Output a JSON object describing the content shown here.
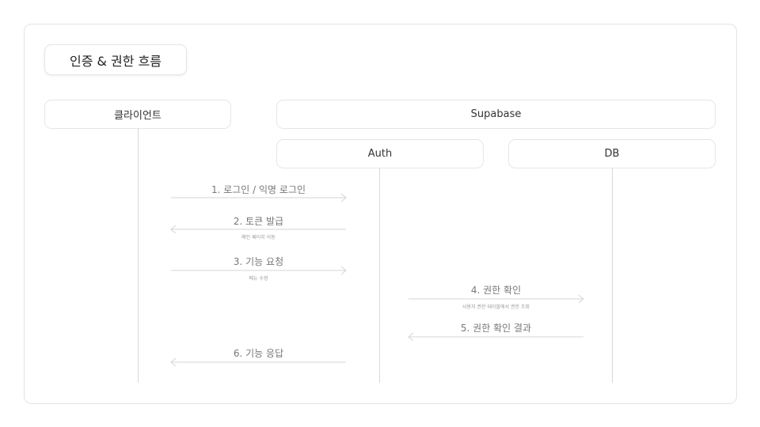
{
  "title": "인증 & 권한 흐름",
  "participants": {
    "client": "클라이언트",
    "supabase": "Supabase",
    "auth": "Auth",
    "db": "DB"
  },
  "messages": [
    {
      "label": "1. 로그인 / 익명 로그인",
      "note": "",
      "direction": "right"
    },
    {
      "label": "2. 토큰 발급",
      "note": "메인 페이지 이동",
      "direction": "left"
    },
    {
      "label": "3. 기능 요청",
      "note": "메뉴 수정",
      "direction": "right"
    },
    {
      "label": "4. 권한 확인",
      "note": "사용자 권한 테이블에서 권한 조회",
      "direction": "right"
    },
    {
      "label": "5. 권한 확인 결과",
      "note": "",
      "direction": "left"
    },
    {
      "label": "6. 기능 응답",
      "note": "",
      "direction": "left"
    }
  ]
}
